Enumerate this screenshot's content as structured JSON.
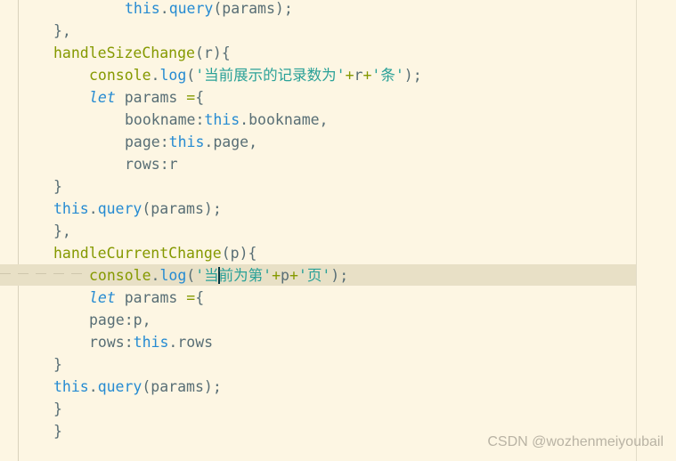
{
  "lines": [
    {
      "indent": 140,
      "tokens": [
        {
          "t": "this",
          "c": "kw"
        },
        {
          "t": ".",
          "c": "pl"
        },
        {
          "t": "query",
          "c": "kw"
        },
        {
          "t": "(params);",
          "c": "pl"
        }
      ]
    },
    {
      "indent": 60,
      "tokens": [
        {
          "t": "},",
          "c": "pl"
        }
      ]
    },
    {
      "indent": 60,
      "tokens": [
        {
          "t": "handleSizeChange",
          "c": "fn"
        },
        {
          "t": "(r){",
          "c": "pl"
        }
      ]
    },
    {
      "indent": 100,
      "tokens": [
        {
          "t": "console",
          "c": "fn"
        },
        {
          "t": ".",
          "c": "pl"
        },
        {
          "t": "log",
          "c": "kw"
        },
        {
          "t": "(",
          "c": "pl"
        },
        {
          "t": "'当前展示的记录数为'",
          "c": "str"
        },
        {
          "t": "+",
          "c": "op"
        },
        {
          "t": "r",
          "c": "pl"
        },
        {
          "t": "+",
          "c": "op"
        },
        {
          "t": "'条'",
          "c": "str"
        },
        {
          "t": ");",
          "c": "pl"
        }
      ]
    },
    {
      "indent": 100,
      "tokens": [
        {
          "t": "let",
          "c": "it"
        },
        {
          "t": " params ",
          "c": "pl"
        },
        {
          "t": "=",
          "c": "op"
        },
        {
          "t": "{",
          "c": "pl"
        }
      ]
    },
    {
      "indent": 140,
      "tokens": [
        {
          "t": "bookname:",
          "c": "pl"
        },
        {
          "t": "this",
          "c": "kw"
        },
        {
          "t": ".bookname,",
          "c": "pl"
        }
      ]
    },
    {
      "indent": 140,
      "tokens": [
        {
          "t": "page:",
          "c": "pl"
        },
        {
          "t": "this",
          "c": "kw"
        },
        {
          "t": ".page,",
          "c": "pl"
        }
      ]
    },
    {
      "indent": 140,
      "tokens": [
        {
          "t": "rows:r",
          "c": "pl"
        }
      ]
    },
    {
      "indent": 60,
      "tokens": [
        {
          "t": "}",
          "c": "pl"
        }
      ]
    },
    {
      "indent": 60,
      "tokens": [
        {
          "t": "this",
          "c": "kw"
        },
        {
          "t": ".",
          "c": "pl"
        },
        {
          "t": "query",
          "c": "kw"
        },
        {
          "t": "(params);",
          "c": "pl"
        }
      ]
    },
    {
      "indent": 60,
      "tokens": [
        {
          "t": "},",
          "c": "pl"
        }
      ]
    },
    {
      "indent": 60,
      "tokens": [
        {
          "t": "handleCurrentChange",
          "c": "fn"
        },
        {
          "t": "(p){",
          "c": "pl"
        }
      ]
    },
    {
      "indent": 100,
      "current": true,
      "tokens": [
        {
          "t": "console",
          "c": "fn"
        },
        {
          "t": ".",
          "c": "pl"
        },
        {
          "t": "log",
          "c": "kw"
        },
        {
          "t": "(",
          "c": "pl"
        },
        {
          "t": "'当",
          "c": "str"
        },
        {
          "caret": true
        },
        {
          "t": "前为第'",
          "c": "str"
        },
        {
          "t": "+",
          "c": "op"
        },
        {
          "t": "p",
          "c": "pl"
        },
        {
          "t": "+",
          "c": "op"
        },
        {
          "t": "'页'",
          "c": "str"
        },
        {
          "t": ");",
          "c": "pl"
        }
      ]
    },
    {
      "indent": 100,
      "tokens": [
        {
          "t": "let",
          "c": "it"
        },
        {
          "t": " params ",
          "c": "pl"
        },
        {
          "t": "=",
          "c": "op"
        },
        {
          "t": "{",
          "c": "pl"
        }
      ]
    },
    {
      "indent": 100,
      "tokens": [
        {
          "t": "page:p,",
          "c": "pl"
        }
      ]
    },
    {
      "indent": 100,
      "tokens": [
        {
          "t": "rows:",
          "c": "pl"
        },
        {
          "t": "this",
          "c": "kw"
        },
        {
          "t": ".rows",
          "c": "pl"
        }
      ]
    },
    {
      "indent": 60,
      "tokens": [
        {
          "t": "}",
          "c": "pl"
        }
      ]
    },
    {
      "indent": 60,
      "tokens": [
        {
          "t": "this",
          "c": "kw"
        },
        {
          "t": ".",
          "c": "pl"
        },
        {
          "t": "query",
          "c": "kw"
        },
        {
          "t": "(params);",
          "c": "pl"
        }
      ]
    },
    {
      "indent": 60,
      "tokens": [
        {
          "t": "}",
          "c": "pl"
        }
      ]
    },
    {
      "indent": 60,
      "tokens": [
        {
          "t": "}",
          "c": "pl"
        }
      ]
    }
  ],
  "watermark": "CSDN @wozhenmeiyoubail",
  "colors": {
    "background": "#fdf6e3",
    "keyword": "#268bd2",
    "function": "#859900",
    "string": "#2aa198",
    "plain": "#586e75",
    "current_line": "#e8e0c6"
  }
}
